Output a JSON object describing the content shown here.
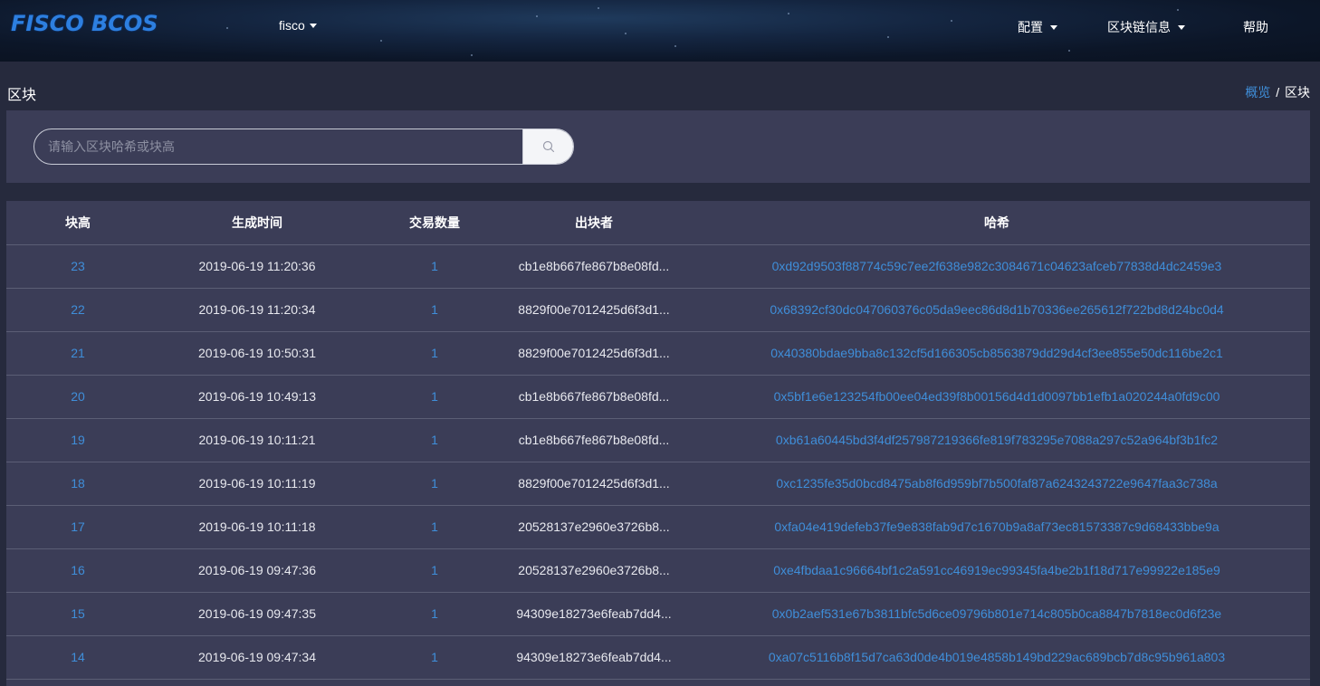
{
  "header": {
    "logo": "FISCO BCOS",
    "group_label": "fisco",
    "menu": [
      {
        "label": "配置",
        "has_dropdown": true
      },
      {
        "label": "区块链信息",
        "has_dropdown": true
      },
      {
        "label": "帮助",
        "has_dropdown": false
      }
    ]
  },
  "page": {
    "title": "区块",
    "breadcrumb": {
      "home": "概览",
      "separator": "/",
      "current": "区块"
    }
  },
  "search": {
    "placeholder": "请输入区块哈希或块高",
    "value": "",
    "button_icon": "search-icon"
  },
  "table": {
    "columns": [
      "块高",
      "生成时间",
      "交易数量",
      "出块者",
      "哈希"
    ],
    "rows": [
      {
        "height": "23",
        "time": "2019-06-19 11:20:36",
        "tx_count": "1",
        "sealer": "cb1e8b667fe867b8e08fd...",
        "hash": "0xd92d9503f88774c59c7ee2f638e982c3084671c04623afceb77838d4dc2459e3"
      },
      {
        "height": "22",
        "time": "2019-06-19 11:20:34",
        "tx_count": "1",
        "sealer": "8829f00e7012425d6f3d1...",
        "hash": "0x68392cf30dc047060376c05da9eec86d8d1b70336ee265612f722bd8d24bc0d4"
      },
      {
        "height": "21",
        "time": "2019-06-19 10:50:31",
        "tx_count": "1",
        "sealer": "8829f00e7012425d6f3d1...",
        "hash": "0x40380bdae9bba8c132cf5d166305cb8563879dd29d4cf3ee855e50dc116be2c1"
      },
      {
        "height": "20",
        "time": "2019-06-19 10:49:13",
        "tx_count": "1",
        "sealer": "cb1e8b667fe867b8e08fd...",
        "hash": "0x5bf1e6e123254fb00ee04ed39f8b00156d4d1d0097bb1efb1a020244a0fd9c00"
      },
      {
        "height": "19",
        "time": "2019-06-19 10:11:21",
        "tx_count": "1",
        "sealer": "cb1e8b667fe867b8e08fd...",
        "hash": "0xb61a60445bd3f4df257987219366fe819f783295e7088a297c52a964bf3b1fc2"
      },
      {
        "height": "18",
        "time": "2019-06-19 10:11:19",
        "tx_count": "1",
        "sealer": "8829f00e7012425d6f3d1...",
        "hash": "0xc1235fe35d0bcd8475ab8f6d959bf7b500faf87a6243243722e9647faa3c738a"
      },
      {
        "height": "17",
        "time": "2019-06-19 10:11:18",
        "tx_count": "1",
        "sealer": "20528137e2960e3726b8...",
        "hash": "0xfa04e419defeb37fe9e838fab9d7c1670b9a8af73ec81573387c9d68433bbe9a"
      },
      {
        "height": "16",
        "time": "2019-06-19 09:47:36",
        "tx_count": "1",
        "sealer": "20528137e2960e3726b8...",
        "hash": "0xe4fbdaa1c96664bf1c2a591cc46919ec99345fa4be2b1f18d717e99922e185e9"
      },
      {
        "height": "15",
        "time": "2019-06-19 09:47:35",
        "tx_count": "1",
        "sealer": "94309e18273e6feab7dd4...",
        "hash": "0x0b2aef531e67b3811bfc5d6ce09796b801e714c805b0ca8847b7818ec0d6f23e"
      },
      {
        "height": "14",
        "time": "2019-06-19 09:47:34",
        "tx_count": "1",
        "sealer": "94309e18273e6feab7dd4...",
        "hash": "0xa07c5116b8f15d7ca63d0de4b019e4858b149bd229ac689bcb7d8c95b961a803"
      }
    ]
  },
  "colors": {
    "accent_link": "#3f8ed9",
    "panel_bg": "#3b3d57",
    "page_bg": "#262a3d",
    "logo_blue": "#2d7fe0"
  }
}
